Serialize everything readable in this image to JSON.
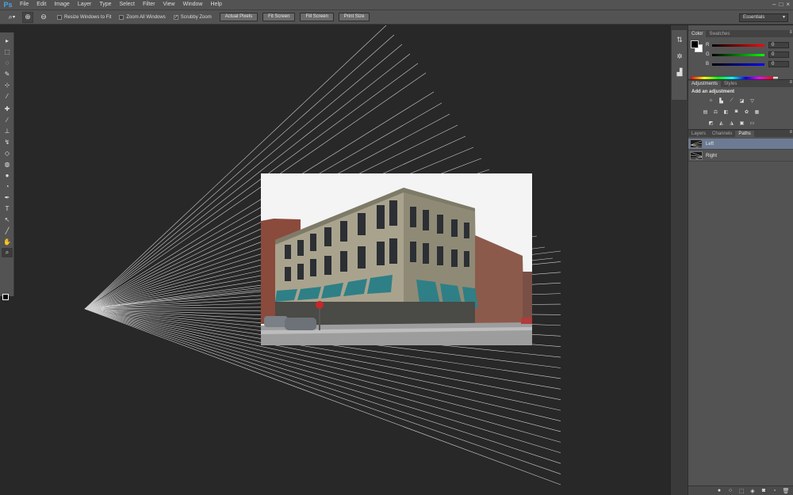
{
  "app": {
    "logo": "Ps"
  },
  "menu": [
    "File",
    "Edit",
    "Image",
    "Layer",
    "Type",
    "Select",
    "Filter",
    "View",
    "Window",
    "Help"
  ],
  "window_controls": {
    "minimize": "–",
    "maximize": "□",
    "close": "×"
  },
  "options_bar": {
    "checks": [
      {
        "label": "Resize Windows to Fit",
        "checked": false
      },
      {
        "label": "Zoom All Windows",
        "checked": false
      },
      {
        "label": "Scrubby Zoom",
        "checked": true
      }
    ],
    "buttons": [
      "Actual Pixels",
      "Fit Screen",
      "Fill Screen",
      "Print Size"
    ],
    "workspace": "Essentials"
  },
  "tools": [
    {
      "name": "move-tool-icon",
      "glyph": "▸"
    },
    {
      "name": "marquee-tool-icon",
      "glyph": "⬚"
    },
    {
      "name": "lasso-tool-icon",
      "glyph": "◌"
    },
    {
      "name": "quick-select-tool-icon",
      "glyph": "✎"
    },
    {
      "name": "crop-tool-icon",
      "glyph": "⊹"
    },
    {
      "name": "eyedropper-tool-icon",
      "glyph": "⁄"
    },
    {
      "name": "healing-brush-tool-icon",
      "glyph": "✚"
    },
    {
      "name": "brush-tool-icon",
      "glyph": "∕"
    },
    {
      "name": "clone-stamp-tool-icon",
      "glyph": "⊥"
    },
    {
      "name": "history-brush-tool-icon",
      "glyph": "↯"
    },
    {
      "name": "eraser-tool-icon",
      "glyph": "◇"
    },
    {
      "name": "paint-bucket-tool-icon",
      "glyph": "◍"
    },
    {
      "name": "blur-tool-icon",
      "glyph": "●"
    },
    {
      "name": "dodge-tool-icon",
      "glyph": "◔"
    },
    {
      "name": "pen-tool-icon",
      "glyph": "✒"
    },
    {
      "name": "type-tool-icon",
      "glyph": "T"
    },
    {
      "name": "path-selection-tool-icon",
      "glyph": "↖"
    },
    {
      "name": "line-tool-icon",
      "glyph": "╱"
    },
    {
      "name": "hand-tool-icon",
      "glyph": "✋"
    },
    {
      "name": "zoom-tool-icon",
      "glyph": "⌕"
    }
  ],
  "dock": [
    "history-icon",
    "adjust-icon",
    "histogram-icon"
  ],
  "color_panel": {
    "tabs": [
      "Color",
      "Swatches"
    ],
    "rows": [
      {
        "label": "R",
        "value": "0",
        "gradient": [
          "#000000",
          "#ff0000"
        ]
      },
      {
        "label": "G",
        "value": "0",
        "gradient": [
          "#000000",
          "#00ff00"
        ]
      },
      {
        "label": "B",
        "value": "0",
        "gradient": [
          "#000000",
          "#0000ff"
        ]
      }
    ]
  },
  "adjustments_panel": {
    "tabs": [
      "Adjustments",
      "Styles"
    ],
    "title": "Add an adjustment"
  },
  "layers_panel": {
    "tabs": [
      "Layers",
      "Channels",
      "Paths"
    ],
    "paths": [
      {
        "name": "Left",
        "selected": true
      },
      {
        "name": "Right",
        "selected": false
      }
    ]
  }
}
